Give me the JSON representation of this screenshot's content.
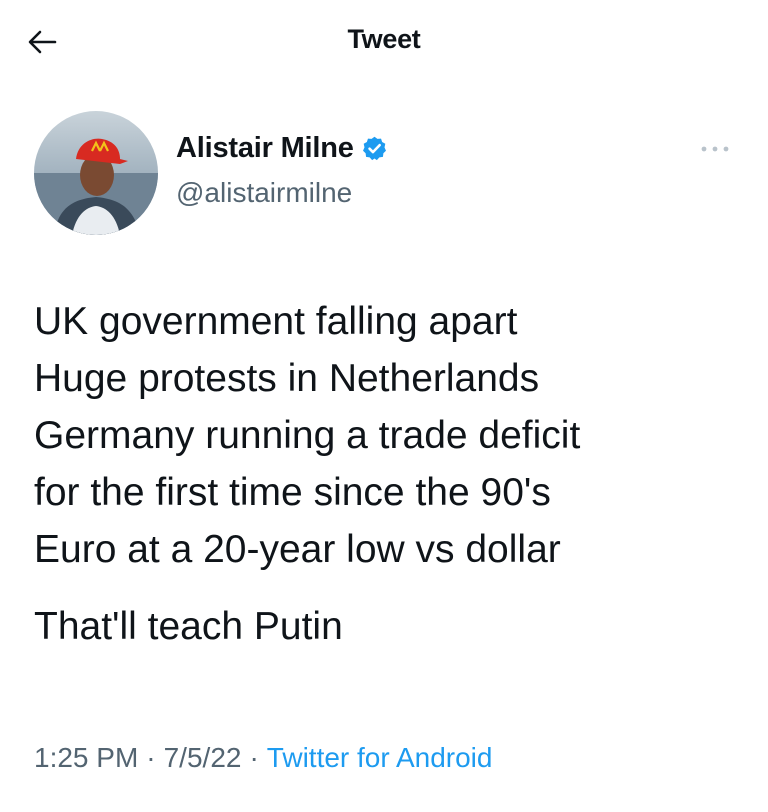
{
  "header": {
    "title": "Tweet",
    "back_icon": "arrow-left-icon"
  },
  "author": {
    "display_name": "Alistair Milne",
    "handle": "@alistairmilne",
    "verified": true,
    "verified_color": "#1d9bf0",
    "avatar_icon": "profile-photo",
    "more_icon": "more-dots-icon"
  },
  "tweet": {
    "lines": [
      "UK government falling apart",
      "Huge protests in Netherlands",
      "Germany running a trade deficit",
      "for the first time since the 90's",
      "Euro at a 20-year low vs dollar"
    ],
    "punchline": "That'll teach Putin"
  },
  "meta": {
    "time": "1:25 PM",
    "date": "7/5/22",
    "separator": "·",
    "source": "Twitter for Android"
  },
  "colors": {
    "text": "#0f1419",
    "secondary": "#536471",
    "accent": "#1d9bf0"
  }
}
